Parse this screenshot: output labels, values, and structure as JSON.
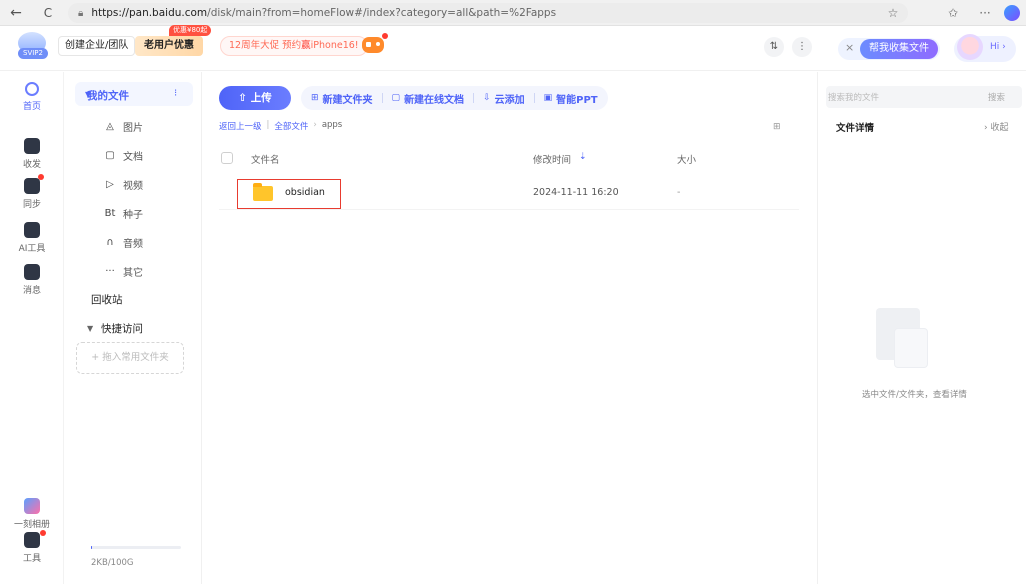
{
  "browser": {
    "url_host": "https://pan.baidu.com",
    "url_path": "/disk/main?from=homeFlow#/index?category=all&path=%2Fapps",
    "back": "←",
    "refresh": "C",
    "more": "···"
  },
  "topbar": {
    "logo_tag": "SVIP2",
    "enterprise": "创建企业/团队",
    "new_user": "老用户优惠",
    "discount_badge": "优惠¥80起",
    "promo_pre": "12周年大促 预约",
    "promo_hl": "赢",
    "promo_post": "iPhone16!",
    "transfer": "⇅",
    "kebab": "⋮",
    "close": "×",
    "help": "帮我收集文件",
    "hi": "Hi ›"
  },
  "leftnav": [
    {
      "label": "首页",
      "icon": "home-icon"
    },
    {
      "label": "收发",
      "icon": "send-receive-icon"
    },
    {
      "label": "同步",
      "icon": "sync-icon"
    },
    {
      "label": "AI工具",
      "icon": "ai-tools-icon"
    },
    {
      "label": "消息",
      "icon": "message-icon"
    },
    {
      "label": "一刻相册",
      "icon": "album-icon"
    },
    {
      "label": "工具",
      "icon": "tools-icon"
    }
  ],
  "sidebar": {
    "my_files": "我的文件",
    "items": [
      {
        "icon": "◬",
        "label": "图片"
      },
      {
        "icon": "▢",
        "label": "文档"
      },
      {
        "icon": "▷",
        "label": "视频"
      },
      {
        "icon": "Bt",
        "label": "种子"
      },
      {
        "icon": "∩",
        "label": "音频"
      },
      {
        "icon": "···",
        "label": "其它"
      }
    ],
    "recycle": "回收站",
    "quick_access": "快捷访问",
    "drop_hint": "+ 拖入常用文件夹",
    "quota": "2KB/100G",
    "quota_fraction": 0.01
  },
  "toolbar": {
    "upload": "上传",
    "new_folder": "新建文件夹",
    "new_online_doc": "新建在线文档",
    "cloud_add": "云添加",
    "smart_ppt": "智能PPT"
  },
  "breadcrumb": {
    "back": "返回上一级",
    "all_files": "全部文件",
    "current": "apps"
  },
  "table": {
    "headers": {
      "name": "文件名",
      "modified": "修改时间",
      "size": "大小"
    },
    "rows": [
      {
        "name": "obsidian",
        "modified": "2024-11-11 16:20",
        "size": "-"
      }
    ]
  },
  "right_panel": {
    "search_placeholder": "搜索我的文件",
    "search_button": "搜索",
    "title": "文件详情",
    "collapse": "› 收起",
    "empty": "选中文件/文件夹，查看详情"
  },
  "colors": {
    "accent": "#4f64f8",
    "folder": "#ffc52b",
    "highlight": "#e83b2f"
  }
}
